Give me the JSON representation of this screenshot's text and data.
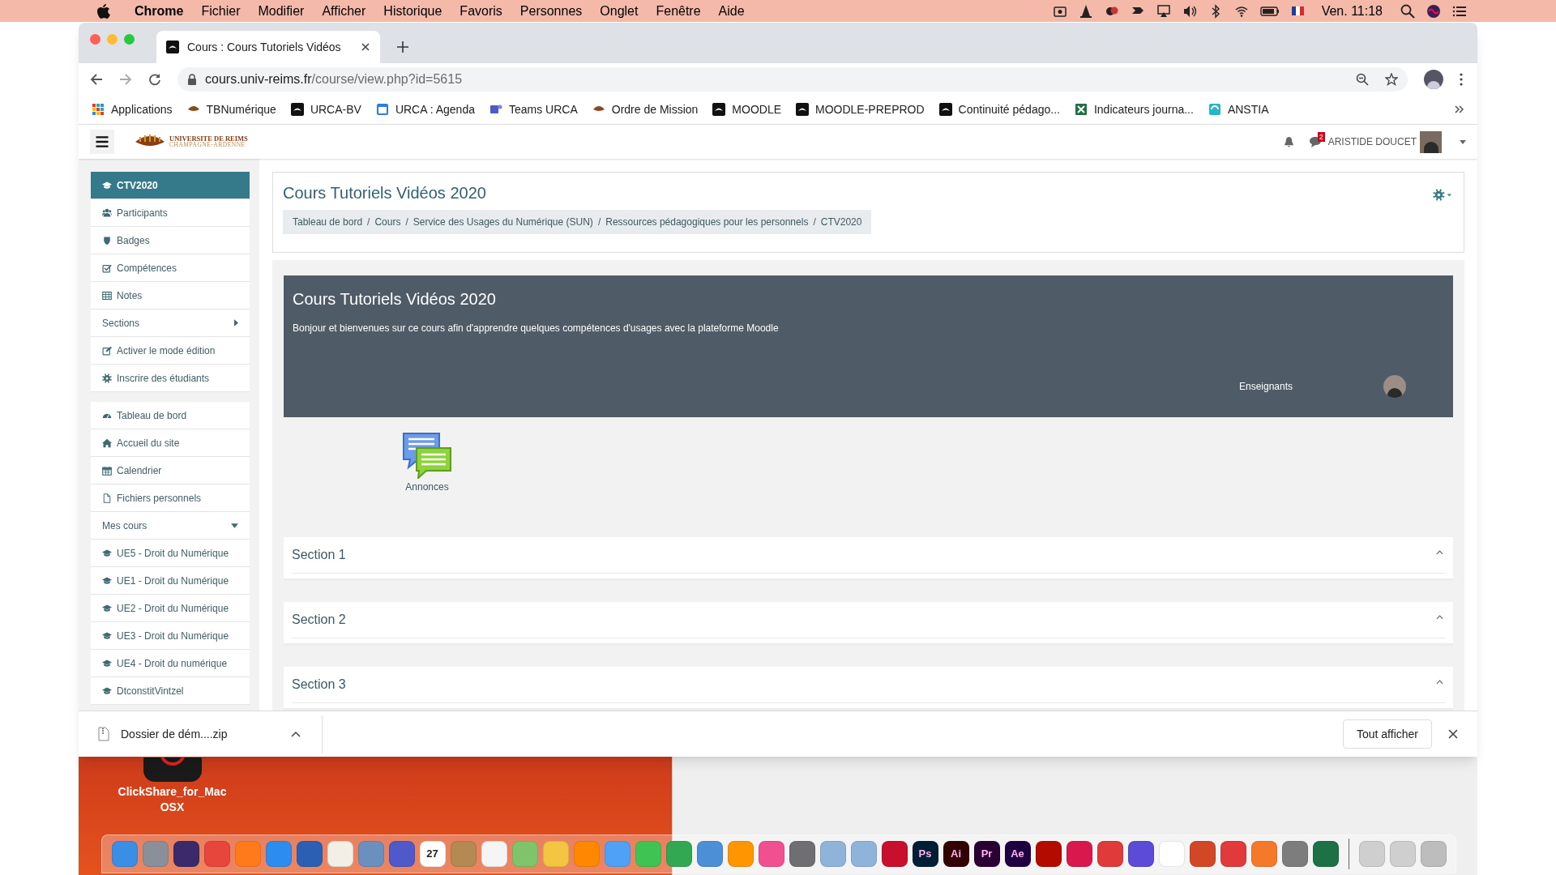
{
  "menu_bar": {
    "app": "Chrome",
    "menus": [
      "Fichier",
      "Modifier",
      "Afficher",
      "Historique",
      "Favoris",
      "Personnes",
      "Onglet",
      "Fenêtre",
      "Aide"
    ],
    "clock": "Ven. 11:18"
  },
  "tabs": [
    {
      "title": "Cours : Cours Tutoriels Vidéos",
      "selected": true
    }
  ],
  "address": {
    "domain": "cours.univ-reims.fr",
    "path": "/course/view.php?id=5615"
  },
  "bookmarks": [
    {
      "label": "Applications",
      "kind": "grid"
    },
    {
      "label": "TBNumérique",
      "kind": "urca"
    },
    {
      "label": "URCA-BV",
      "kind": "moodle"
    },
    {
      "label": "URCA : Agenda",
      "kind": "calendar"
    },
    {
      "label": "Teams URCA",
      "kind": "teams"
    },
    {
      "label": "Ordre de Mission",
      "kind": "urca"
    },
    {
      "label": "MOODLE",
      "kind": "moodle"
    },
    {
      "label": "MOODLE-PREPROD",
      "kind": "moodle"
    },
    {
      "label": "Continuité pédago...",
      "kind": "moodle"
    },
    {
      "label": "Indicateurs journa...",
      "kind": "sheet"
    },
    {
      "label": "ANSTIA",
      "kind": "page"
    }
  ],
  "navbar": {
    "logo_lines": [
      "UNIVERSITE DE REIMS",
      "CHAMPAGNE-ARDENNE"
    ],
    "message_count": "2",
    "user": "ARISTIDE DOUCET"
  },
  "sidebar": [
    [
      {
        "label": "CTV2020",
        "kind": "link",
        "selected": true
      },
      {
        "label": "Participants",
        "kind": "link",
        "selected": false
      },
      {
        "label": "Badges",
        "kind": "link",
        "selected": false
      },
      {
        "label": "Compétences",
        "kind": "link",
        "selected": false
      },
      {
        "label": "Notes",
        "kind": "link",
        "selected": false
      },
      {
        "label": "Sections",
        "kind": "toggle",
        "expanded": false,
        "selected": false
      },
      {
        "label": "Activer le mode édition",
        "kind": "link",
        "selected": false
      },
      {
        "label": "Inscrire des étudiants",
        "kind": "link",
        "selected": false
      }
    ],
    [
      {
        "label": "Tableau de bord",
        "kind": "link",
        "selected": false
      },
      {
        "label": "Accueil du site",
        "kind": "link",
        "selected": false
      },
      {
        "label": "Calendrier",
        "kind": "link",
        "selected": false
      },
      {
        "label": "Fichiers personnels",
        "kind": "link",
        "selected": false
      },
      {
        "label": "Mes cours",
        "kind": "toggle",
        "expanded": true,
        "selected": false
      },
      {
        "label": "UE5 - Droit du Numérique",
        "kind": "link",
        "selected": false
      },
      {
        "label": "UE1 - Droit du Numérique",
        "kind": "link",
        "selected": false
      },
      {
        "label": "UE2 - Droit du Numérique",
        "kind": "link",
        "selected": false
      },
      {
        "label": "UE3 - Droit du Numérique",
        "kind": "link",
        "selected": false
      },
      {
        "label": "UE4 - Droit du numérique",
        "kind": "link",
        "selected": false
      },
      {
        "label": "DtconstitVintzel",
        "kind": "link",
        "selected": false
      }
    ]
  ],
  "header": {
    "title": "Cours Tutoriels Vidéos 2020",
    "breadcrumb_separator": "/",
    "breadcrumb": [
      "Tableau de bord",
      "Cours",
      "Service des Usages du Numérique (SUN)",
      "Ressources pédagogiques pour les personnels",
      "CTV2020"
    ]
  },
  "banner": {
    "title": "Cours Tutoriels Vidéos 2020",
    "text": "Bonjour et bienvenues sur ce cours afin d'apprendre quelques compétences d'usages avec la plateforme Moodle",
    "teachers_label": "Enseignants"
  },
  "activity": {
    "label": "Annonces"
  },
  "sections": [
    {
      "title": "Section 1",
      "expanded": true
    },
    {
      "title": "Section 2",
      "expanded": true
    },
    {
      "title": "Section 3",
      "expanded": true
    }
  ],
  "download_bar": {
    "file": "Dossier de dém....zip",
    "show_all": "Tout afficher"
  },
  "desktop_icon": {
    "label": "ClickShare_for_MacOSX"
  },
  "dock": [
    {
      "color": "#3a8ee6"
    },
    {
      "color": "#8a8f99"
    },
    {
      "color": "#3b2a6b"
    },
    {
      "color": "#e8453c"
    },
    {
      "color": "#ff7a1a"
    },
    {
      "color": "#2d8cf0"
    },
    {
      "color": "#2b5fb4"
    },
    {
      "color": "#f1efe6"
    },
    {
      "color": "#6b8fbf"
    },
    {
      "color": "#5059c9"
    },
    {
      "color": "#ffffff",
      "label": "27"
    },
    {
      "color": "#b58a52"
    },
    {
      "color": "#f5f5f5"
    },
    {
      "color": "#7fc36b"
    },
    {
      "color": "#f4c542"
    },
    {
      "color": "#ff8800"
    },
    {
      "color": "#4ea1f7"
    },
    {
      "color": "#3fc454"
    },
    {
      "color": "#33a852"
    },
    {
      "color": "#4d8fd6"
    },
    {
      "color": "#ff9500"
    },
    {
      "color": "#f0508f"
    },
    {
      "color": "#6e6e73"
    },
    {
      "color": "#8fb3d9"
    },
    {
      "color": "#8fb3d9"
    },
    {
      "color": "#c8102e"
    },
    {
      "color": "#001e36",
      "label": "Ps"
    },
    {
      "color": "#330000",
      "label": "Ai"
    },
    {
      "color": "#2a0034",
      "label": "Pr"
    },
    {
      "color": "#1f0040",
      "label": "Ae"
    },
    {
      "color": "#b30b00"
    },
    {
      "color": "#d7194d"
    },
    {
      "color": "#e03a3a"
    },
    {
      "color": "#5b4bd6"
    },
    {
      "color": "#ffffff"
    },
    {
      "color": "#d24726"
    },
    {
      "color": "#e03a3a"
    },
    {
      "color": "#f5792a"
    },
    {
      "color": "#7d7d7d"
    },
    {
      "color": "#1e7145"
    },
    {
      "color": "#cfcfcf"
    },
    {
      "color": "#cfcfcf"
    },
    {
      "color": "#bdbdbd"
    }
  ]
}
